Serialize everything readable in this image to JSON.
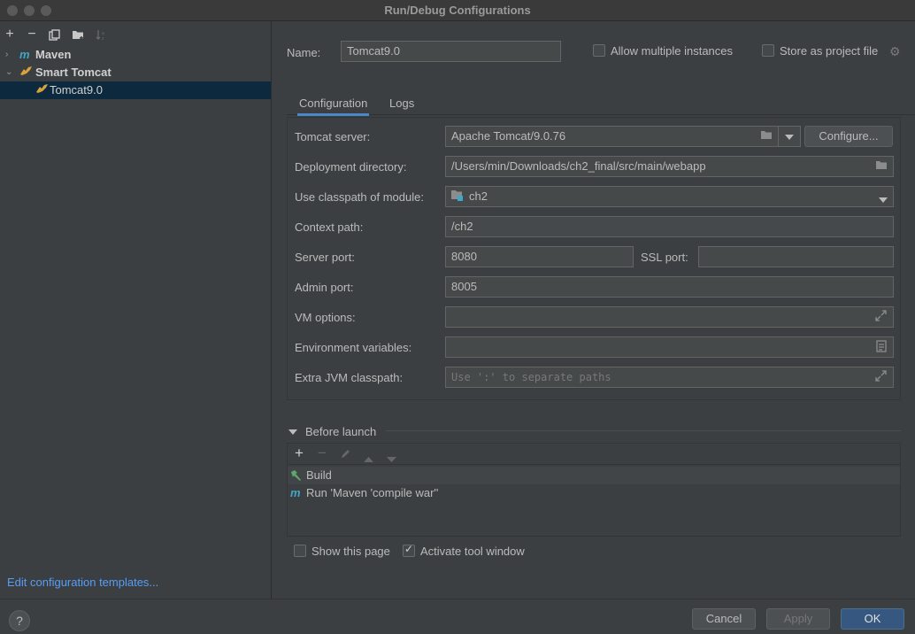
{
  "window": {
    "title": "Run/Debug Configurations"
  },
  "left_toolbar": {
    "icons": [
      "add-icon",
      "remove-icon",
      "copy-icon",
      "folder-add-icon",
      "sort-icon"
    ]
  },
  "tree": {
    "items": [
      {
        "label": "Maven",
        "icon_letter": "m",
        "expanded": false
      },
      {
        "label": "Smart Tomcat",
        "icon_letter": "🐈",
        "expanded": true
      },
      {
        "label": "Tomcat9.0",
        "selected": true
      }
    ]
  },
  "edit_templates_link": "Edit configuration templates...",
  "name_row": {
    "label": "Name:",
    "value": "Tomcat9.0",
    "allow_multiple_label": "Allow multiple instances",
    "allow_multiple_checked": false,
    "store_project_label": "Store as project file",
    "store_project_checked": false
  },
  "tabs": {
    "configuration": "Configuration",
    "logs": "Logs",
    "active": "Configuration"
  },
  "config": {
    "tomcat_server_label": "Tomcat server:",
    "tomcat_server_value": "Apache Tomcat/9.0.76",
    "configure_button": "Configure...",
    "deploy_dir_label": "Deployment directory:",
    "deploy_dir_value": "/Users/min/Downloads/ch2_final/src/main/webapp",
    "classpath_module_label": "Use classpath of module:",
    "classpath_module_value": "ch2",
    "context_path_label": "Context path:",
    "context_path_value": "/ch2",
    "server_port_label": "Server port:",
    "server_port_value": "8080",
    "ssl_port_label": "SSL port:",
    "ssl_port_value": "",
    "admin_port_label": "Admin port:",
    "admin_port_value": "8005",
    "vm_options_label": "VM options:",
    "vm_options_value": "",
    "env_vars_label": "Environment variables:",
    "env_vars_value": "",
    "extra_jvm_label": "Extra JVM classpath:",
    "extra_jvm_placeholder": "Use ':' to separate paths"
  },
  "before_launch": {
    "title": "Before launch",
    "items": [
      {
        "label": "Build",
        "icon": "hammer-icon"
      },
      {
        "label": "Run 'Maven 'compile war''",
        "icon": "maven-icon"
      }
    ]
  },
  "options": {
    "show_page_label": "Show this page",
    "show_page_checked": false,
    "activate_tool_label": "Activate tool window",
    "activate_tool_checked": true
  },
  "footer": {
    "help": "?",
    "cancel": "Cancel",
    "apply": "Apply",
    "ok": "OK"
  },
  "colors": {
    "background": "#3c3f41",
    "selection": "#0d293e",
    "link": "#589df6",
    "primary_button": "#365880",
    "maven_icon": "#3fa7c7",
    "tomcat_icon": "#d9a23b",
    "build_icon": "#5fa86b"
  }
}
